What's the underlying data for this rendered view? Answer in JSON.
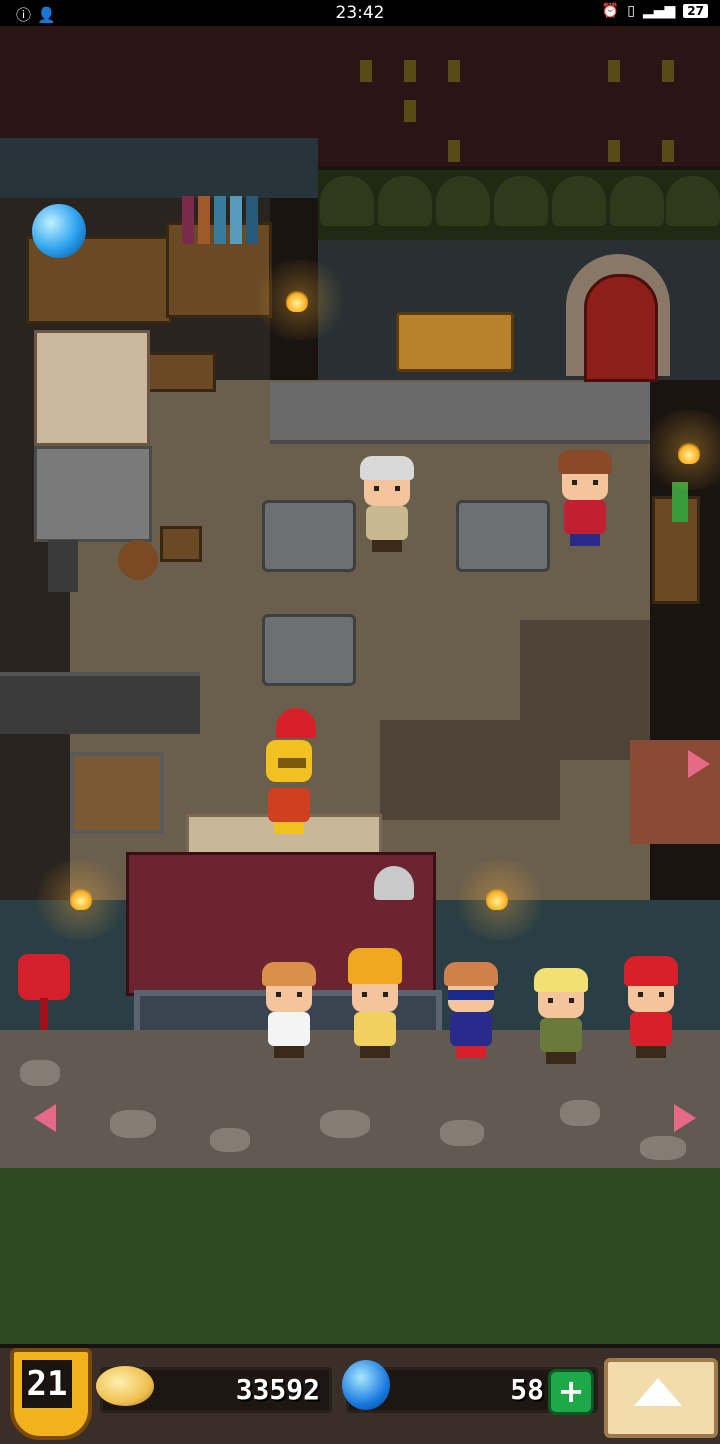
{
  "status_bar": {
    "time": "23:42",
    "left_icons": [
      "info-icon",
      "person-icon"
    ],
    "right_icons": [
      "alarm-icon",
      "vibrate-icon",
      "signal-icon"
    ],
    "battery": "27"
  },
  "scene": {
    "characters": [
      {
        "name": "blacksmith-wizard",
        "hair_color": "#d8d8d8",
        "body_color": "#c8b890"
      },
      {
        "name": "blacksmith-apprentice",
        "hair_color": "#8a4a2a",
        "body_color": "#c02030"
      },
      {
        "name": "hero-knight",
        "hair_color": "#f2c020",
        "body_color": "#d04020"
      },
      {
        "name": "customer-1",
        "hair_color": "#d8904a",
        "body_color": "#f4f4f4"
      },
      {
        "name": "customer-2",
        "hair_color": "#f0a820",
        "body_color": "#f2d060"
      },
      {
        "name": "customer-3",
        "hair_color": "#d0804a",
        "body_color": "#2a2a8a"
      },
      {
        "name": "customer-4",
        "hair_color": "#f2e070",
        "body_color": "#6a7a3a"
      },
      {
        "name": "customer-5",
        "hair_color": "#d8202a",
        "body_color": "#d8202a"
      }
    ]
  },
  "hud": {
    "level": "21",
    "coins": "33592",
    "gems": "58",
    "add_gems_label": "+",
    "colors": {
      "accent": "#1fa84a",
      "badge": "#f2b21c"
    }
  }
}
